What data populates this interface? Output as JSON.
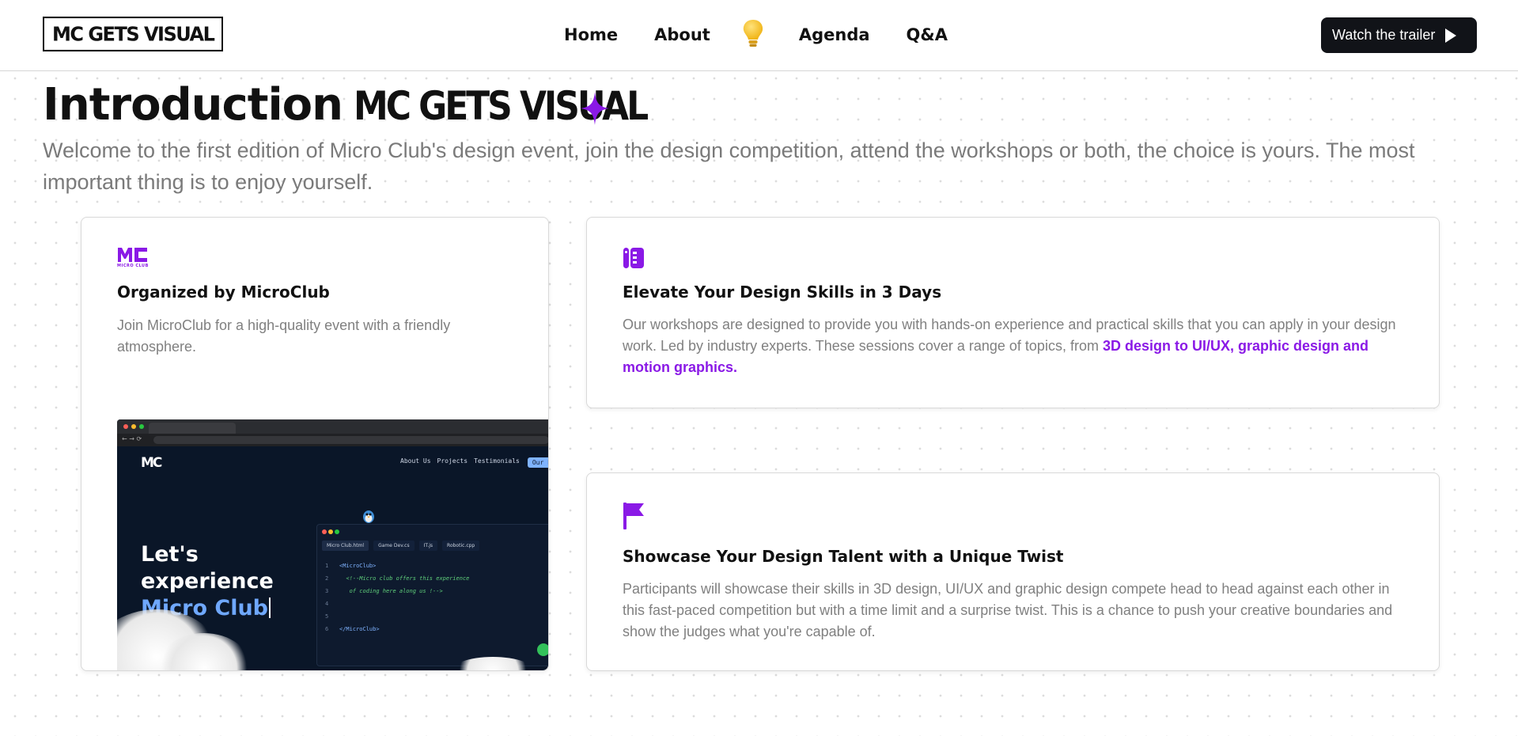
{
  "header": {
    "logo_text": "MC GETS VISUAL",
    "nav": {
      "home": "Home",
      "about": "About",
      "bulb_icon": "lightbulb-icon",
      "agenda": "Agenda",
      "qa": "Q&A"
    },
    "trailer_button": "Watch the trailer"
  },
  "intro": {
    "title_word": "Introduction",
    "title_brand": "MC GETS VISUAL",
    "sparkle_icon": "sparkle-icon",
    "description": "Welcome to the first edition of Micro Club's design event, join the design competition, attend the workshops or both, the choice is yours. The most important thing is to enjoy yourself."
  },
  "cards": [
    {
      "icon": "microclub-logo-icon",
      "icon_caption": "MICRO CLUB",
      "title": "Organized by MicroClub",
      "text": "Join MicroClub for a high-quality event with a friendly atmosphere."
    },
    {
      "icon": "sketchbook-icon",
      "title": "Elevate Your Design Skills in 3 Days",
      "text": "Our workshops are designed to provide you with hands-on experience and practical skills that you can apply in your design work. Led by industry experts. These sessions cover a range of topics, from ",
      "highlight": "3D design to UI/UX, graphic design and motion graphics."
    },
    {
      "icon": "flag-icon",
      "title": "Showcase Your Design Talent with a Unique Twist",
      "text": "Participants will showcase their skills in 3D design, UI/UX and graphic design compete head to head against each other in this fast-paced competition but with a time limit and a surprise twist. This is a chance to push your creative boundaries and show the judges what you're capable of."
    }
  ],
  "screenshot": {
    "logo": "MC",
    "menu": [
      "About Us",
      "Projects",
      "Testimonials"
    ],
    "menu_button": "Our Even",
    "headline_line1": "Let's",
    "headline_line2": "experience",
    "headline_line3": "Micro Club",
    "editor_tabs": [
      "Micro Club.html",
      "Game Dev.cs",
      "IT.js",
      "Robotic.cpp"
    ],
    "code_lines": [
      {
        "n": "1",
        "text": "<MicroClub>"
      },
      {
        "n": "2",
        "text": "<!--Micro club offers this experience"
      },
      {
        "n": "3",
        "text": "of coding here along us !-->"
      },
      {
        "n": "4",
        "text": ""
      },
      {
        "n": "5",
        "text": ""
      },
      {
        "n": "6",
        "text": "</MicroClub>"
      }
    ]
  },
  "colors": {
    "accent": "#8a19e6",
    "nav_button_bg": "#111318",
    "muted_text": "#7a7a7a",
    "bulb": "#f5c431"
  }
}
